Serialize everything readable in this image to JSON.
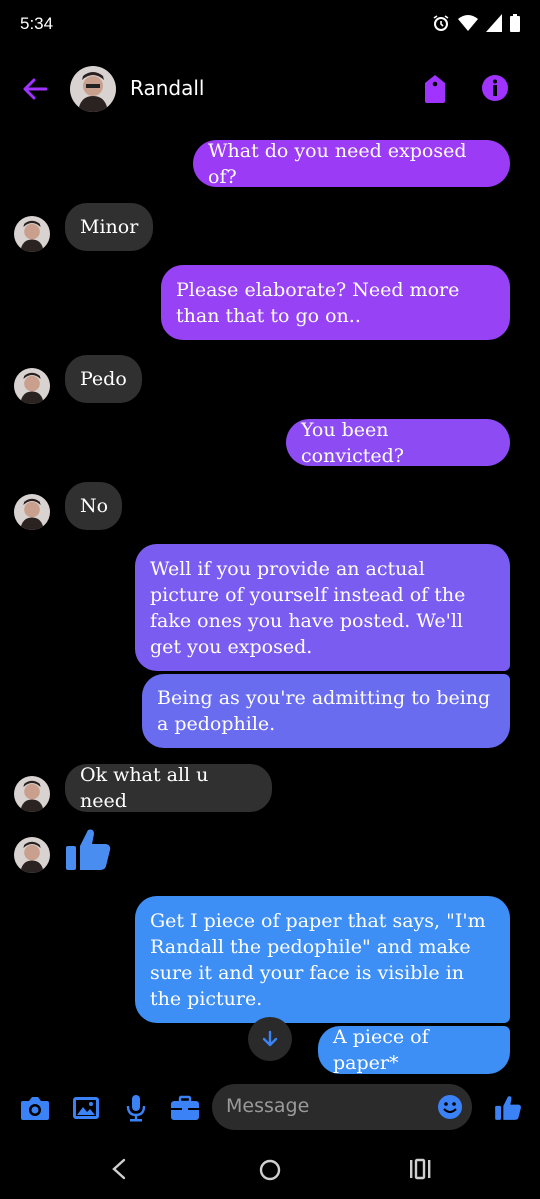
{
  "status": {
    "time": "5:34"
  },
  "header": {
    "contact_name": "Randall"
  },
  "messages": [
    {
      "text": "What do you need exposed of?"
    },
    {
      "text": "Minor"
    },
    {
      "text": "Please elaborate? Need more than that to go on.."
    },
    {
      "text": "Pedo"
    },
    {
      "text": "You been convicted?"
    },
    {
      "text": "No"
    },
    {
      "text": "Well if you provide an actual picture of yourself instead of the fake ones you have posted. We'll get you exposed."
    },
    {
      "text": "Being as you're admitting to being a pedophile."
    },
    {
      "text": "Ok what all u need"
    },
    {
      "text": "Get I piece of paper that says, \"I'm Randall the pedophile\" and make sure it and your face is visible in the picture."
    },
    {
      "text": "A piece of paper*"
    }
  ],
  "composer": {
    "placeholder": "Message"
  },
  "colors": {
    "accent": "#a033ff",
    "outgoing_purple": "#9b3bf5",
    "outgoing_violet": "#7a5cf0",
    "outgoing_blue": "#3d8ef5",
    "incoming": "#303030",
    "composer_icon": "#3b82f6"
  },
  "icons": [
    "back-arrow-icon",
    "tag-icon",
    "info-icon",
    "camera-icon",
    "image-icon",
    "microphone-icon",
    "briefcase-icon",
    "emoji-icon",
    "thumbs-up-icon",
    "arrow-down-icon"
  ]
}
